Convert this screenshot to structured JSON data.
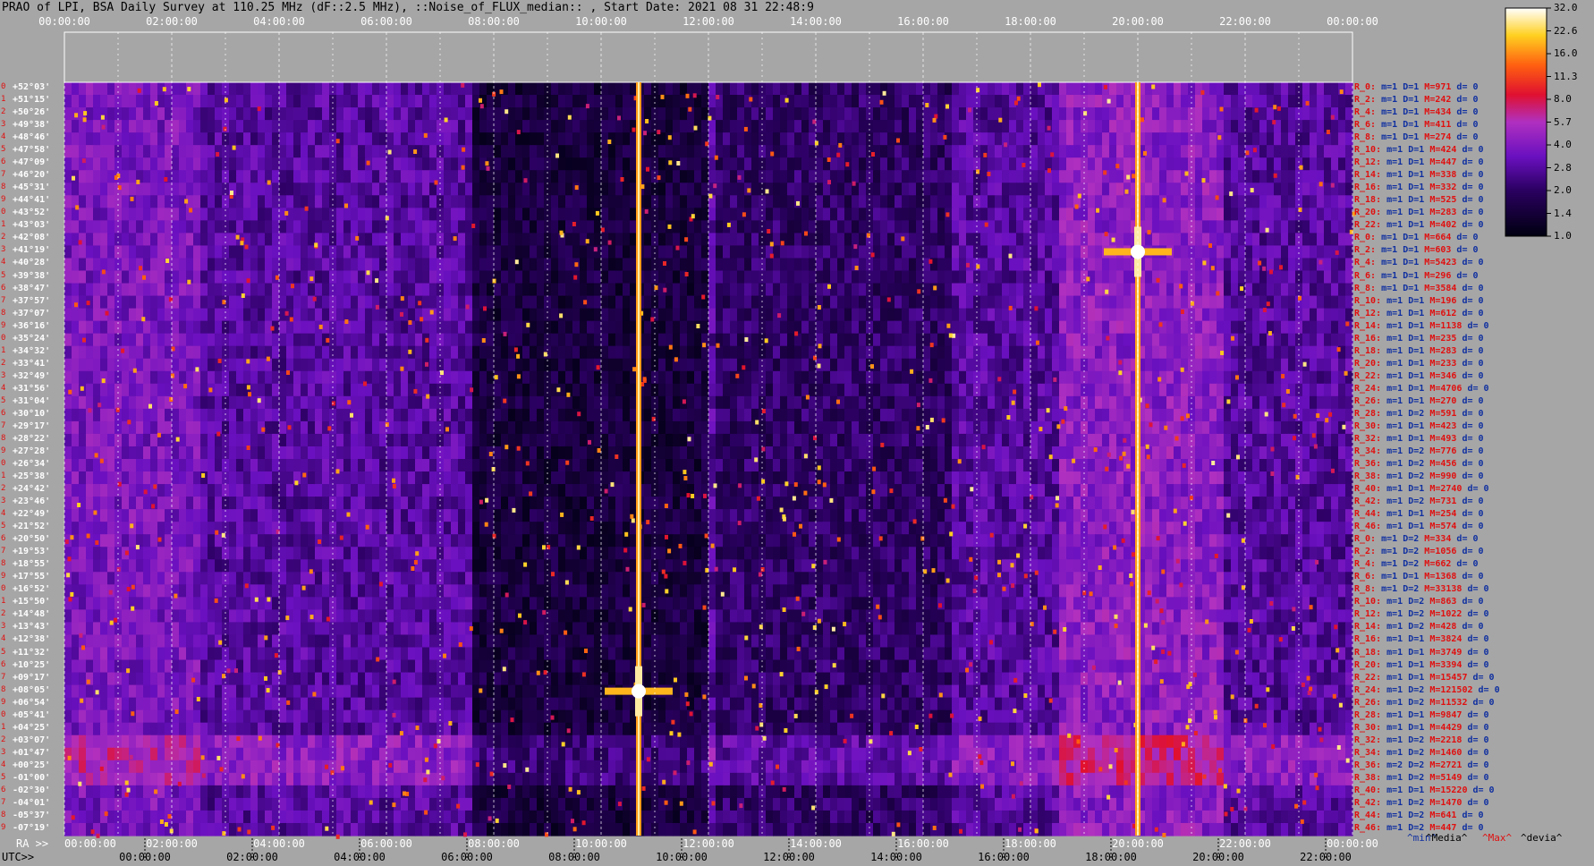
{
  "title": "PRAO of LPI, BSA Daily Survey at 110.25 MHz (dF::2.5 MHz), ::Noise_of_FLUX_median:: , Start Date: 2021 08 31 22:48:9",
  "colors": {
    "background": "#a6a6a6",
    "label_red": "#e01010",
    "label_blue": "#1030a0"
  },
  "chart_data": {
    "type": "heatmap",
    "x_axis_top": {
      "ticks": [
        "00:00:00",
        "02:00:00",
        "04:00:00",
        "06:00:00",
        "08:00:00",
        "10:00:00",
        "12:00:00",
        "14:00:00",
        "16:00:00",
        "18:00:00",
        "20:00:00",
        "22:00:00",
        "00:00:00"
      ]
    },
    "x_axis_ra": {
      "label": "RA >>",
      "ticks": [
        "00:00:00",
        "02:00:00",
        "04:00:00",
        "06:00:00",
        "08:00:00",
        "10:00:00",
        "12:00:00",
        "14:00:00",
        "16:00:00",
        "18:00:00",
        "20:00:00",
        "22:00:00",
        "00:00:00"
      ]
    },
    "x_axis_utc": {
      "label": "UTC>>",
      "ticks": [
        "00:00:00",
        "02:00:00",
        "04:00:00",
        "06:00:00",
        "08:00:00",
        "10:00:00",
        "12:00:00",
        "14:00:00",
        "16:00:00",
        "18:00:00",
        "20:00:00",
        "22:00:00"
      ]
    },
    "declinations": [
      "+52°03'",
      "+51°15'",
      "+50°26'",
      "+49°38'",
      "+48°46'",
      "+47°58'",
      "+47°09'",
      "+46°20'",
      "+45°31'",
      "+44°41'",
      "+43°52'",
      "+43°03'",
      "+42°08'",
      "+41°19'",
      "+40°28'",
      "+39°38'",
      "+38°47'",
      "+37°57'",
      "+37°07'",
      "+36°16'",
      "+35°24'",
      "+34°32'",
      "+33°41'",
      "+32°49'",
      "+31°56'",
      "+31°04'",
      "+30°10'",
      "+29°17'",
      "+28°22'",
      "+27°28'",
      "+26°34'",
      "+25°38'",
      "+24°42'",
      "+23°46'",
      "+22°49'",
      "+21°52'",
      "+20°50'",
      "+19°53'",
      "+18°55'",
      "+17°55'",
      "+16°52'",
      "+15°50'",
      "+14°48'",
      "+13°43'",
      "+12°38'",
      "+11°32'",
      "+10°25'",
      "+09°17'",
      "+08°05'",
      "+06°54'",
      "+05°41'",
      "+04°25'",
      "+03°07'",
      "+01°47'",
      "+00°25'",
      "-01°00'",
      "-02°30'",
      "-04°01'",
      "-05°37'",
      "-07°19'"
    ],
    "row_stats": [
      {
        "r": "R_0:",
        "m": "1",
        "D": "1",
        "M": "971"
      },
      {
        "r": "R_2:",
        "m": "1",
        "D": "1",
        "M": "242"
      },
      {
        "r": "R_4:",
        "m": "1",
        "D": "1",
        "M": "434"
      },
      {
        "r": "R_6:",
        "m": "1",
        "D": "1",
        "M": "411"
      },
      {
        "r": "R_8:",
        "m": "1",
        "D": "1",
        "M": "274"
      },
      {
        "r": "R_10:",
        "m": "1",
        "D": "1",
        "M": "424"
      },
      {
        "r": "R_12:",
        "m": "1",
        "D": "1",
        "M": "447"
      },
      {
        "r": "R_14:",
        "m": "1",
        "D": "1",
        "M": "338"
      },
      {
        "r": "R_16:",
        "m": "1",
        "D": "1",
        "M": "332"
      },
      {
        "r": "R_18:",
        "m": "1",
        "D": "1",
        "M": "525"
      },
      {
        "r": "R_20:",
        "m": "1",
        "D": "1",
        "M": "283"
      },
      {
        "r": "R_22:",
        "m": "1",
        "D": "1",
        "M": "402"
      },
      {
        "r": "R_0:",
        "m": "1",
        "D": "1",
        "M": "664"
      },
      {
        "r": "R_2:",
        "m": "1",
        "D": "1",
        "M": "603"
      },
      {
        "r": "R_4:",
        "m": "1",
        "D": "1",
        "M": "5423"
      },
      {
        "r": "R_6:",
        "m": "1",
        "D": "1",
        "M": "296"
      },
      {
        "r": "R_8:",
        "m": "1",
        "D": "1",
        "M": "3584"
      },
      {
        "r": "R_10:",
        "m": "1",
        "D": "1",
        "M": "196"
      },
      {
        "r": "R_12:",
        "m": "1",
        "D": "1",
        "M": "612"
      },
      {
        "r": "R_14:",
        "m": "1",
        "D": "1",
        "M": "1138"
      },
      {
        "r": "R_16:",
        "m": "1",
        "D": "1",
        "M": "235"
      },
      {
        "r": "R_18:",
        "m": "1",
        "D": "1",
        "M": "283"
      },
      {
        "r": "R_20:",
        "m": "1",
        "D": "1",
        "M": "233"
      },
      {
        "r": "R_22:",
        "m": "1",
        "D": "1",
        "M": "346"
      },
      {
        "r": "R_24:",
        "m": "1",
        "D": "1",
        "M": "4706"
      },
      {
        "r": "R_26:",
        "m": "1",
        "D": "1",
        "M": "270"
      },
      {
        "r": "R_28:",
        "m": "1",
        "D": "2",
        "M": "591"
      },
      {
        "r": "R_30:",
        "m": "1",
        "D": "1",
        "M": "423"
      },
      {
        "r": "R_32:",
        "m": "1",
        "D": "1",
        "M": "493"
      },
      {
        "r": "R_34:",
        "m": "1",
        "D": "2",
        "M": "776"
      },
      {
        "r": "R_36:",
        "m": "1",
        "D": "2",
        "M": "456"
      },
      {
        "r": "R_38:",
        "m": "1",
        "D": "2",
        "M": "990"
      },
      {
        "r": "R_40:",
        "m": "1",
        "D": "1",
        "M": "2740"
      },
      {
        "r": "R_42:",
        "m": "1",
        "D": "2",
        "M": "731"
      },
      {
        "r": "R_44:",
        "m": "1",
        "D": "1",
        "M": "254"
      },
      {
        "r": "R_46:",
        "m": "1",
        "D": "1",
        "M": "574"
      },
      {
        "r": "R_0:",
        "m": "1",
        "D": "2",
        "M": "334"
      },
      {
        "r": "R_2:",
        "m": "1",
        "D": "2",
        "M": "1056"
      },
      {
        "r": "R_4:",
        "m": "1",
        "D": "2",
        "M": "662"
      },
      {
        "r": "R_6:",
        "m": "1",
        "D": "1",
        "M": "1368"
      },
      {
        "r": "R_8:",
        "m": "1",
        "D": "2",
        "M": "33138"
      },
      {
        "r": "R_10:",
        "m": "1",
        "D": "2",
        "M": "863"
      },
      {
        "r": "R_12:",
        "m": "1",
        "D": "2",
        "M": "1022"
      },
      {
        "r": "R_14:",
        "m": "1",
        "D": "2",
        "M": "428"
      },
      {
        "r": "R_16:",
        "m": "1",
        "D": "1",
        "M": "3824"
      },
      {
        "r": "R_18:",
        "m": "1",
        "D": "1",
        "M": "3749"
      },
      {
        "r": "R_20:",
        "m": "1",
        "D": "1",
        "M": "3394"
      },
      {
        "r": "R_22:",
        "m": "1",
        "D": "1",
        "M": "15457"
      },
      {
        "r": "R_24:",
        "m": "1",
        "D": "2",
        "M": "121502"
      },
      {
        "r": "R_26:",
        "m": "1",
        "D": "2",
        "M": "11532"
      },
      {
        "r": "R_28:",
        "m": "1",
        "D": "1",
        "M": "9847"
      },
      {
        "r": "R_30:",
        "m": "1",
        "D": "1",
        "M": "4429"
      },
      {
        "r": "R_32:",
        "m": "1",
        "D": "2",
        "M": "2218"
      },
      {
        "r": "R_34:",
        "m": "1",
        "D": "2",
        "M": "1460"
      },
      {
        "r": "R_36:",
        "m": "2",
        "D": "2",
        "M": "2721"
      },
      {
        "r": "R_38:",
        "m": "1",
        "D": "2",
        "M": "5149"
      },
      {
        "r": "R_40:",
        "m": "1",
        "D": "1",
        "M": "15220"
      },
      {
        "r": "R_42:",
        "m": "1",
        "D": "2",
        "M": "1470"
      },
      {
        "r": "R_44:",
        "m": "1",
        "D": "2",
        "M": "641"
      },
      {
        "r": "R_46:",
        "m": "1",
        "D": "2",
        "M": "447"
      }
    ],
    "colorbar": {
      "ticks": [
        "32.0",
        "22.6",
        "16.0",
        "11.3",
        "8.0",
        "5.7",
        "4.0",
        "2.8",
        "2.0",
        "1.4",
        "1.0"
      ],
      "range": [
        1.0,
        32.0
      ],
      "scale": "log"
    },
    "footer_legend": [
      "^min^",
      "^Media^",
      "^Max^",
      "^devia^"
    ],
    "bright_sources": [
      {
        "ra_hours": 10.7,
        "dec_row": 48
      },
      {
        "ra_hours": 20.0,
        "dec_row": 13
      }
    ]
  }
}
